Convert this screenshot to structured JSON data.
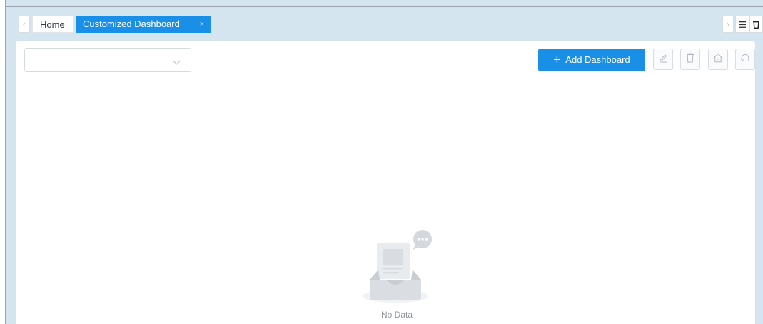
{
  "tabs": {
    "items": [
      {
        "label": "Home"
      },
      {
        "label": "Customized Dashboard",
        "close": "×"
      }
    ],
    "prev_glyph": "‹",
    "next_glyph": "›"
  },
  "toolbar": {
    "dashboard_select_value": "",
    "add_dashboard_label": "Add Dashboard",
    "add_dashboard_icon": "+"
  },
  "empty_state": {
    "text": "No Data"
  },
  "colors": {
    "accent": "#1a8fe8",
    "frame": "#d4e5f0"
  },
  "icons": [
    "chevron-left-icon",
    "chevron-right-icon",
    "menu-icon",
    "clear-icon",
    "chevron-down-icon",
    "edit-icon",
    "delete-icon",
    "home-icon",
    "refresh-icon",
    "empty-inbox-icon"
  ]
}
